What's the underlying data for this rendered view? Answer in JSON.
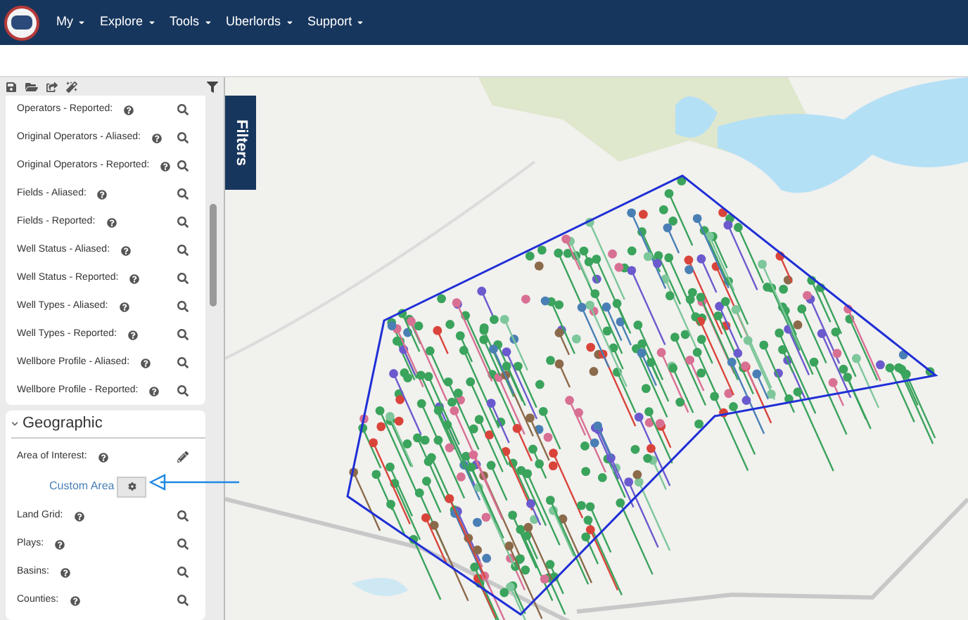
{
  "nav": {
    "menus": [
      {
        "label": "My",
        "dropdown": true
      },
      {
        "label": "Explore",
        "dropdown": true
      },
      {
        "label": "Tools",
        "dropdown": true
      },
      {
        "label": "Uberlords",
        "dropdown": true
      },
      {
        "label": "Support",
        "dropdown": true
      }
    ]
  },
  "filters_tab": {
    "label": "Filters"
  },
  "filter_list": [
    {
      "label": "Operators - Reported:",
      "help": true
    },
    {
      "label": "Original Operators - Aliased:",
      "help": true
    },
    {
      "label": "Original Operators - Reported:",
      "help": true
    },
    {
      "label": "Fields - Aliased:",
      "help": true
    },
    {
      "label": "Fields - Reported:",
      "help": true
    },
    {
      "label": "Well Status - Aliased:",
      "help": true
    },
    {
      "label": "Well Status - Reported:",
      "help": true
    },
    {
      "label": "Well Types - Aliased:",
      "help": true
    },
    {
      "label": "Well Types - Reported:",
      "help": true
    },
    {
      "label": "Wellbore Profile - Aliased:",
      "help": true
    },
    {
      "label": "Wellbore Profile - Reported:",
      "help": true
    }
  ],
  "geographic": {
    "title": "Geographic",
    "expanded": true,
    "area_of_interest": {
      "label": "Area of Interest:",
      "help": true,
      "value": "Custom Area"
    },
    "items": [
      {
        "label": "Land Grid:",
        "help": true
      },
      {
        "label": "Plays:",
        "help": true
      },
      {
        "label": "Basins:",
        "help": true
      },
      {
        "label": "Counties:",
        "help": true
      }
    ]
  }
}
